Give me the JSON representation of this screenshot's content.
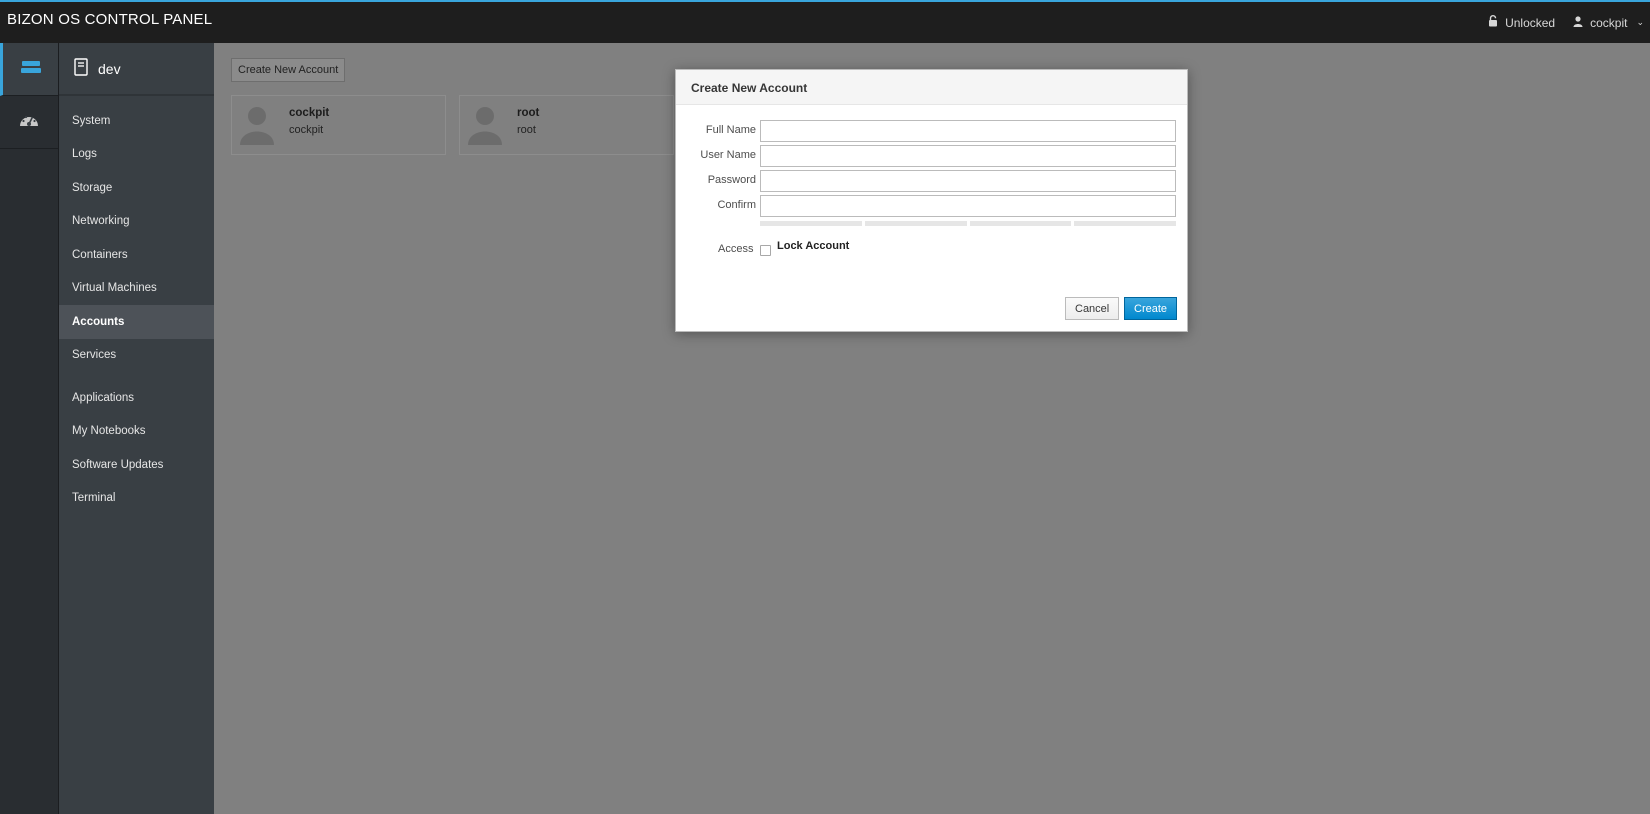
{
  "topbar": {
    "brand": "BIZON OS CONTROL PANEL",
    "lock_status": "Unlocked",
    "user": "cockpit",
    "user_chevron": "⌄"
  },
  "rail": {
    "items": [
      {
        "icon": "server-icon",
        "active": true
      },
      {
        "icon": "dashboard-icon",
        "active": false
      }
    ]
  },
  "nav": {
    "host": "dev",
    "items": [
      {
        "label": "System"
      },
      {
        "label": "Logs"
      },
      {
        "label": "Storage"
      },
      {
        "label": "Networking"
      },
      {
        "label": "Containers"
      },
      {
        "label": "Virtual Machines"
      },
      {
        "label": "Accounts",
        "active": true
      },
      {
        "label": "Services"
      },
      {
        "label": "Applications"
      },
      {
        "label": "My Notebooks"
      },
      {
        "label": "Software Updates"
      },
      {
        "label": "Terminal"
      }
    ]
  },
  "main": {
    "create_button": "Create New Account",
    "accounts": [
      {
        "name": "cockpit",
        "username": "cockpit"
      },
      {
        "name": "root",
        "username": "root"
      }
    ]
  },
  "modal": {
    "title": "Create New Account",
    "fields": {
      "full_name": {
        "label": "Full Name",
        "value": ""
      },
      "user_name": {
        "label": "User Name",
        "value": ""
      },
      "password": {
        "label": "Password",
        "value": ""
      },
      "confirm": {
        "label": "Confirm",
        "value": ""
      }
    },
    "access_label": "Access",
    "lock_account": {
      "label": "Lock Account",
      "checked": false
    },
    "cancel_label": "Cancel",
    "create_label": "Create"
  },
  "colors": {
    "accent": "#39a5dc",
    "primary_button": "#0088ce",
    "topbar": "#1e1e1e",
    "nav_bg": "#393f44",
    "overlay": "#808080"
  }
}
